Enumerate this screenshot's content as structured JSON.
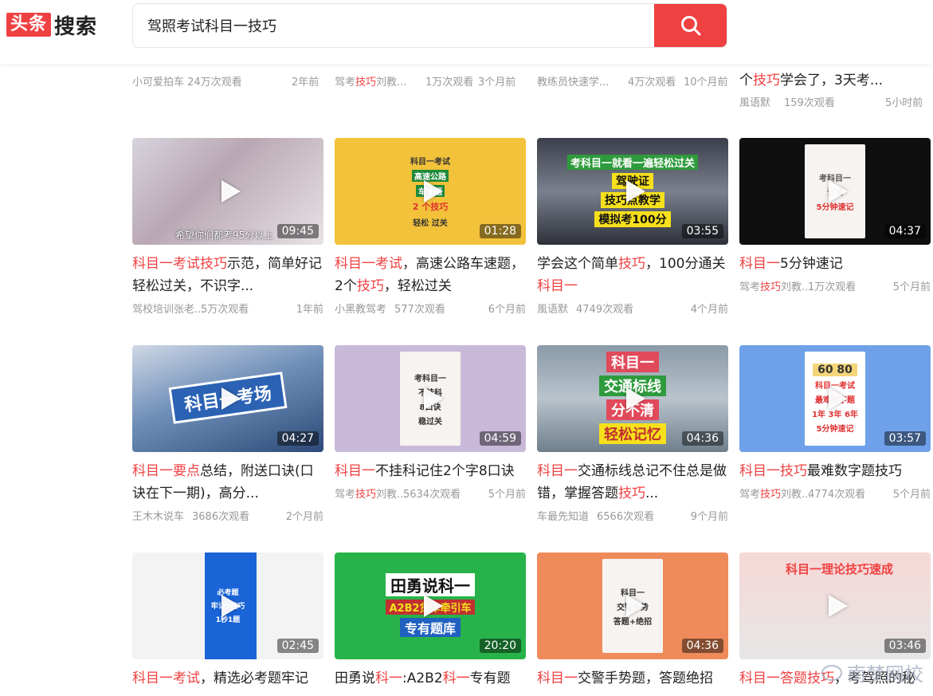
{
  "header": {
    "logo_box": "头条",
    "logo_text": "搜索",
    "search_value": "驾照考试科目一技巧"
  },
  "top_row": [
    {
      "meta": "小可爱拍车  24万次观看",
      "age": "2年前"
    },
    {
      "src": "驾考技巧刘教...",
      "views": "1万次观看",
      "age": "3个月前"
    },
    {
      "src": "教练员快速学...",
      "views": "4万次观看",
      "age": "10个月前"
    },
    {
      "title_a": "个",
      "title_hl": "技巧",
      "title_b": "学会了，3天考...",
      "src": "風语默",
      "views": "159次观看",
      "age": "5小时前"
    }
  ],
  "cards": [
    {
      "duration": "09:45",
      "title_parts": [
        {
          "t": "科目一考试技巧",
          "hl": true
        },
        {
          "t": "示范，简单好记轻松过关，不识字...",
          "hl": false
        }
      ],
      "src": "驾校培训张老...",
      "views": "5万次观看",
      "age": "1年前",
      "caption": "希望你们都考95分以上"
    },
    {
      "duration": "01:28",
      "title_parts": [
        {
          "t": "科目一考试",
          "hl": true
        },
        {
          "t": "，高速公路车速题，2个",
          "hl": false
        },
        {
          "t": "技巧",
          "hl": true
        },
        {
          "t": "，轻松过关",
          "hl": false
        }
      ],
      "src": "小黑教驾考",
      "views": "577次观看",
      "age": "6个月前",
      "inner": [
        "科目一考试",
        "高速公路",
        "车速题",
        "2 个技巧",
        "轻松  过关"
      ]
    },
    {
      "duration": "03:55",
      "title_parts": [
        {
          "t": "学会这个简单",
          "hl": false
        },
        {
          "t": "技巧",
          "hl": true
        },
        {
          "t": "，100分通关",
          "hl": false
        },
        {
          "t": "科目一",
          "hl": true
        }
      ],
      "src": "風语默",
      "views": "4749次观看",
      "age": "4个月前",
      "inner": [
        "考科目一就看一遍轻松过关",
        "驾驶证",
        "技巧点教学",
        "模拟考100分"
      ]
    },
    {
      "duration": "04:37",
      "title_parts": [
        {
          "t": "科目一",
          "hl": true
        },
        {
          "t": "5分钟速记",
          "hl": false
        }
      ],
      "src": "驾考技巧刘教...",
      "views": "1万次观看",
      "age": "5个月前",
      "inner": [
        "考科目一",
        "认准",
        "5分钟速记"
      ]
    },
    {
      "duration": "04:27",
      "title_parts": [
        {
          "t": "科目一要点",
          "hl": true
        },
        {
          "t": "总结，附送口诀(口诀在下一期)，高分...",
          "hl": false
        }
      ],
      "src": "王木木说车",
      "views": "3686次观看",
      "age": "2个月前",
      "inner": [
        "科目一考场"
      ]
    },
    {
      "duration": "04:59",
      "title_parts": [
        {
          "t": "科目一",
          "hl": true
        },
        {
          "t": "不挂科记住2个字8口诀",
          "hl": false
        }
      ],
      "src": "驾考技巧刘教...",
      "views": "5634次观看",
      "age": "5个月前",
      "inner": [
        "考科目一",
        "不挂科",
        "8口诀",
        "稳过关"
      ]
    },
    {
      "duration": "04:36",
      "title_parts": [
        {
          "t": "科目一",
          "hl": true
        },
        {
          "t": "交通标线总记不住总是做错，掌握答题",
          "hl": false
        },
        {
          "t": "技巧",
          "hl": true
        },
        {
          "t": "...",
          "hl": false
        }
      ],
      "src": "车最先知道",
      "views": "6566次观看",
      "age": "9个月前",
      "inner": [
        "科目一",
        "交通标线",
        "分不清",
        "轻松记忆"
      ]
    },
    {
      "duration": "03:57",
      "title_parts": [
        {
          "t": "科目一技巧",
          "hl": true
        },
        {
          "t": "最难数字题技巧",
          "hl": false
        }
      ],
      "src": "驾考技巧刘教...",
      "views": "4774次观看",
      "age": "5个月前",
      "inner": [
        "60  80",
        "科目一考试",
        "最难数字题",
        "1年  3年  6年",
        "5分钟速记"
      ]
    },
    {
      "duration": "02:45",
      "title_parts": [
        {
          "t": "科目一考试",
          "hl": true
        },
        {
          "t": "，精选必考题牢记",
          "hl": false
        }
      ],
      "inner": [
        "必考题",
        "牢记5技巧",
        "1秒1题"
      ]
    },
    {
      "duration": "20:20",
      "title_parts": [
        {
          "t": "田勇说",
          "hl": false
        },
        {
          "t": "科一",
          "hl": true
        },
        {
          "t": ":A2B2",
          "hl": false
        },
        {
          "t": "科一",
          "hl": true
        },
        {
          "t": "专有题",
          "hl": false
        }
      ],
      "inner": [
        "田勇说科一",
        "A2B2货车牵引车",
        "专有题库"
      ]
    },
    {
      "duration": "04:36",
      "title_parts": [
        {
          "t": "科目一",
          "hl": true
        },
        {
          "t": "交警手势题，答题绝招",
          "hl": false
        }
      ],
      "inner": [
        "科目一",
        "交警手势",
        "答题+绝招"
      ]
    },
    {
      "duration": "03:46",
      "title_parts": [
        {
          "t": "科目一答题技巧",
          "hl": true
        },
        {
          "t": "，考驾照的秘",
          "hl": false
        }
      ],
      "inner": [
        "科目一理论技巧速成"
      ]
    }
  ],
  "watermark": "南梦网校",
  "colors": {
    "brand_red": "#f04142",
    "meta_gray": "#999999"
  }
}
